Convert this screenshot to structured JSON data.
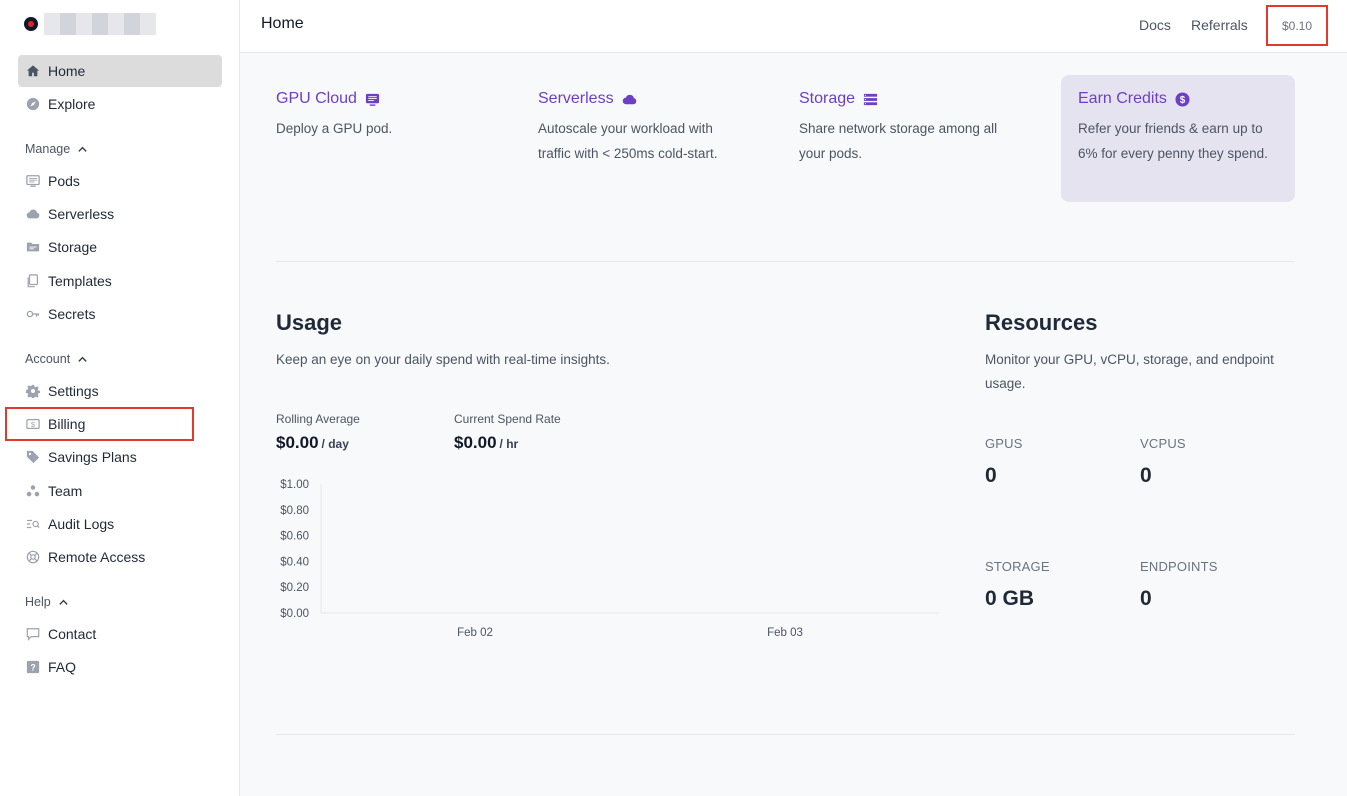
{
  "sidebar": {
    "primary": [
      {
        "label": "Home",
        "icon": "home-icon"
      },
      {
        "label": "Explore",
        "icon": "compass-icon"
      }
    ],
    "manage": {
      "label": "Manage",
      "items": [
        {
          "label": "Pods",
          "icon": "pods-icon"
        },
        {
          "label": "Serverless",
          "icon": "cloud-icon"
        },
        {
          "label": "Storage",
          "icon": "folder-icon"
        },
        {
          "label": "Templates",
          "icon": "templates-icon"
        },
        {
          "label": "Secrets",
          "icon": "key-icon"
        }
      ]
    },
    "account": {
      "label": "Account",
      "items": [
        {
          "label": "Settings",
          "icon": "gear-icon"
        },
        {
          "label": "Billing",
          "icon": "billing-icon"
        },
        {
          "label": "Savings Plans",
          "icon": "tag-icon"
        },
        {
          "label": "Team",
          "icon": "team-icon"
        },
        {
          "label": "Audit Logs",
          "icon": "audit-logs-icon"
        },
        {
          "label": "Remote Access",
          "icon": "remote-access-icon"
        }
      ]
    },
    "help": {
      "label": "Help",
      "items": [
        {
          "label": "Contact",
          "icon": "chat-icon"
        },
        {
          "label": "FAQ",
          "icon": "question-icon"
        }
      ]
    }
  },
  "header": {
    "title": "Home",
    "docs": "Docs",
    "referrals": "Referrals",
    "balance": "$0.10"
  },
  "cards": [
    {
      "title": "GPU Cloud",
      "desc": "Deploy a GPU pod.",
      "icon": "gpu-icon"
    },
    {
      "title": "Serverless",
      "desc": "Autoscale your workload with traffic with < 250ms cold-start.",
      "icon": "cloud-icon"
    },
    {
      "title": "Storage",
      "desc": "Share network storage among all your pods.",
      "icon": "storage-list-icon"
    },
    {
      "title": "Earn Credits",
      "desc": "Refer your friends & earn up to 6% for every penny they spend.",
      "icon": "dollar-circle-icon"
    }
  ],
  "usage": {
    "title": "Usage",
    "subtitle": "Keep an eye on your daily spend with real-time insights.",
    "rolling_label": "Rolling Average",
    "rolling_value": "$0.00",
    "rolling_unit": "/ day",
    "rate_label": "Current Spend Rate",
    "rate_value": "$0.00",
    "rate_unit": "/ hr"
  },
  "resources": {
    "title": "Resources",
    "subtitle": "Monitor your GPU, vCPU, storage, and endpoint usage.",
    "gpus_label": "GPUS",
    "gpus_value": "0",
    "vcpus_label": "VCPUS",
    "vcpus_value": "0",
    "storage_label": "STORAGE",
    "storage_value": "0 GB",
    "endpoints_label": "ENDPOINTS",
    "endpoints_value": "0"
  },
  "chart_data": {
    "type": "line",
    "x": [
      "Feb 02",
      "Feb 03"
    ],
    "series": [
      {
        "values": [
          0,
          0
        ]
      }
    ],
    "y_ticks": [
      "$1.00",
      "$0.80",
      "$0.60",
      "$0.40",
      "$0.20",
      "$0.00"
    ],
    "ylim": [
      0,
      1
    ],
    "grid": false
  }
}
